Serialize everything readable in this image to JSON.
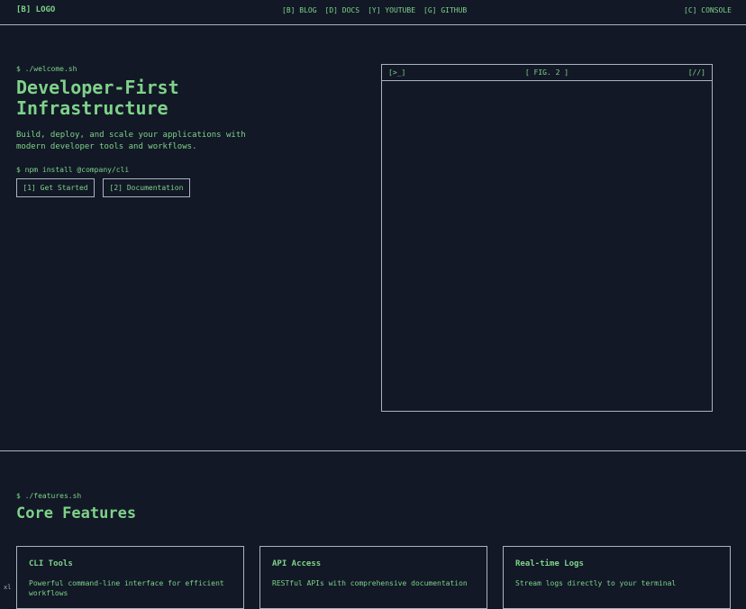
{
  "nav": {
    "logo": "[B] LOGO",
    "links": [
      "[B] BLOG",
      "[D] DOCS",
      "[Y] YOUTUBE",
      "[G] GITHUB"
    ],
    "console": "[C] CONSOLE"
  },
  "hero": {
    "prompt": "$ ./welcome.sh",
    "title": "Developer-First Infrastructure",
    "subtitle": "Build, deploy, and scale your applications with modern developer tools and workflows.",
    "install": "$ npm install @company/cli",
    "buttons": [
      "[1] Get Started",
      "[2] Documentation"
    ]
  },
  "figure": {
    "left": "[>_]",
    "center": "[ FIG. 2 ]",
    "right": "[//]"
  },
  "features": {
    "prompt": "$ ./features.sh",
    "title": "Core Features",
    "cards": [
      {
        "title": "CLI Tools",
        "desc": "Powerful command-line interface for efficient workflows"
      },
      {
        "title": "API Access",
        "desc": "RESTful APIs with comprehensive documentation"
      },
      {
        "title": "Real-time Logs",
        "desc": "Stream logs directly to your terminal"
      }
    ]
  },
  "corner_label": "xl"
}
